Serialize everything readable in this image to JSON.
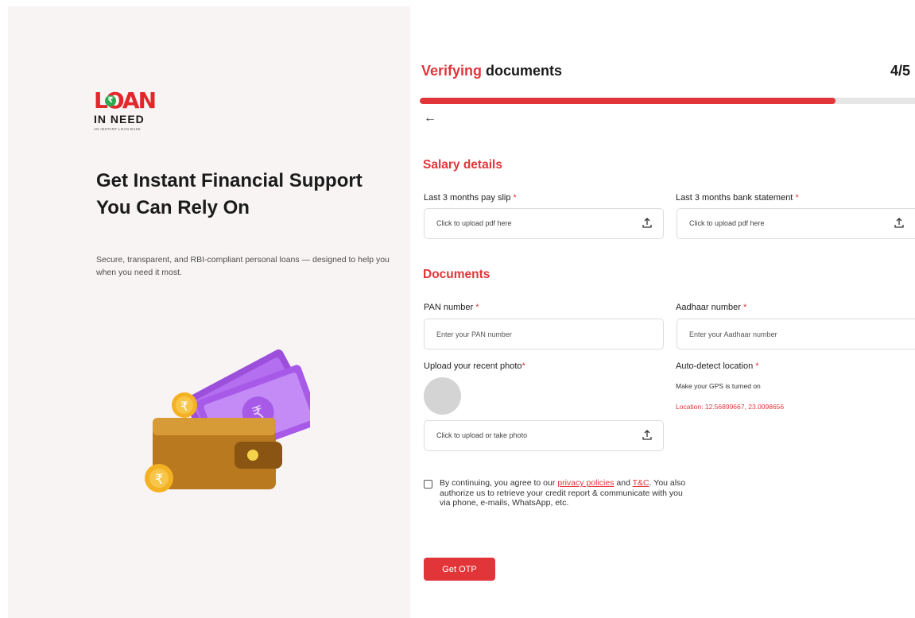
{
  "brand": {
    "logo_word": "LOAN",
    "logo_sub": "IN NEED",
    "logo_tag": "AN INSTANT LOAN BASE",
    "logo_rupee": "₹",
    "accent_color": "#e2353a"
  },
  "hero": {
    "title": "Get Instant Financial Support You Can Rely On",
    "subtitle": "Secure, transparent, and RBI-compliant personal loans — designed to help you when you need it most."
  },
  "header": {
    "title_accent": "Verifying",
    "title_rest": " documents",
    "step": "4/5",
    "progress_fraction": 0.84
  },
  "salary": {
    "heading": "Salary details",
    "payslip_label": "Last 3 months pay slip",
    "payslip_placeholder": "Click to upload pdf here",
    "bank_label": "Last 3 months bank statement",
    "bank_placeholder": "Click to upload pdf here"
  },
  "documents": {
    "heading": "Documents",
    "pan_label": "PAN number",
    "pan_placeholder": "Enter your PAN number",
    "aadhaar_label": "Aadhaar number",
    "aadhaar_placeholder": "Enter your Aadhaar number",
    "photo_label": "Upload your recent photo",
    "photo_placeholder": "Click to upload or take photo",
    "location_label": "Auto-detect location",
    "location_hint": "Make your GPS is turned on",
    "location_value": "Location: 12.56899667, 23.0098656",
    "required_mark": "*"
  },
  "consent": {
    "text_1": "By continuing, you agree to our ",
    "link_privacy": "privacy policies",
    "text_2": " and ",
    "link_tc": "T&C",
    "text_3": ". You also authorize us to retrieve your credit report & communicate with you via phone, e-mails, WhatsApp, etc."
  },
  "actions": {
    "get_otp": "Get OTP"
  }
}
